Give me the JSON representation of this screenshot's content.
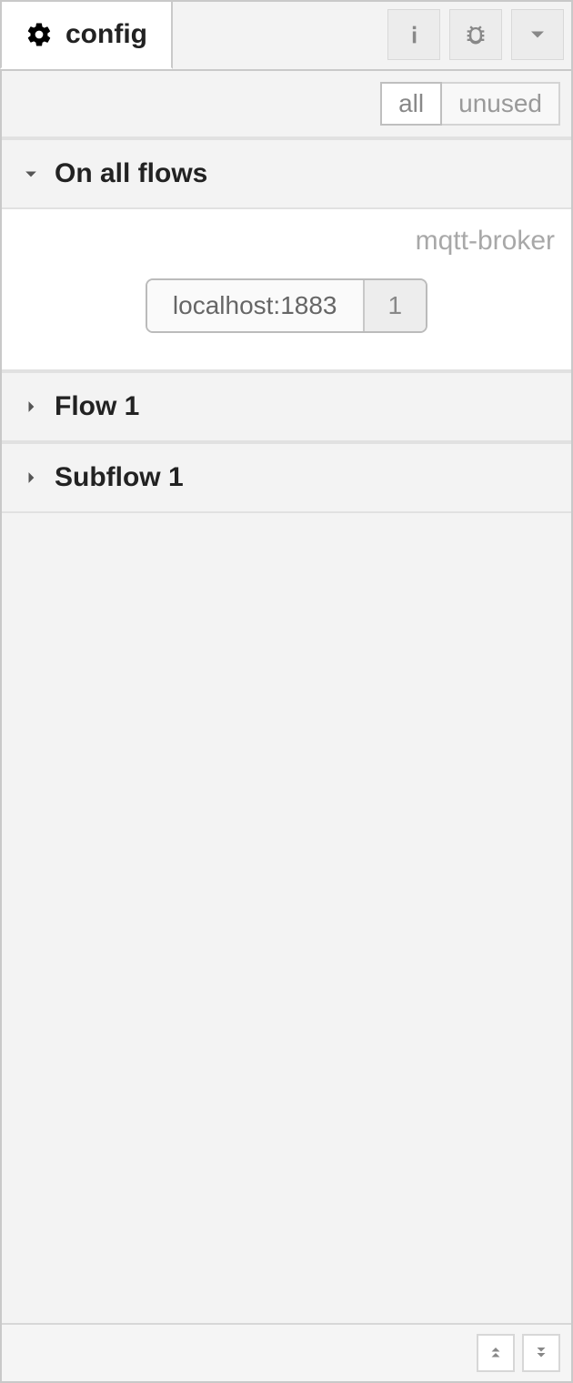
{
  "header": {
    "tab_label": "config"
  },
  "filter": {
    "all_label": "all",
    "unused_label": "unused",
    "active": "all"
  },
  "categories": [
    {
      "label": "On all flows",
      "expanded": true
    },
    {
      "label": "Flow 1",
      "expanded": false
    },
    {
      "label": "Subflow 1",
      "expanded": false
    }
  ],
  "node_type": {
    "type_label": "mqtt-broker",
    "node_name": "localhost:1883",
    "usage_count": "1"
  }
}
